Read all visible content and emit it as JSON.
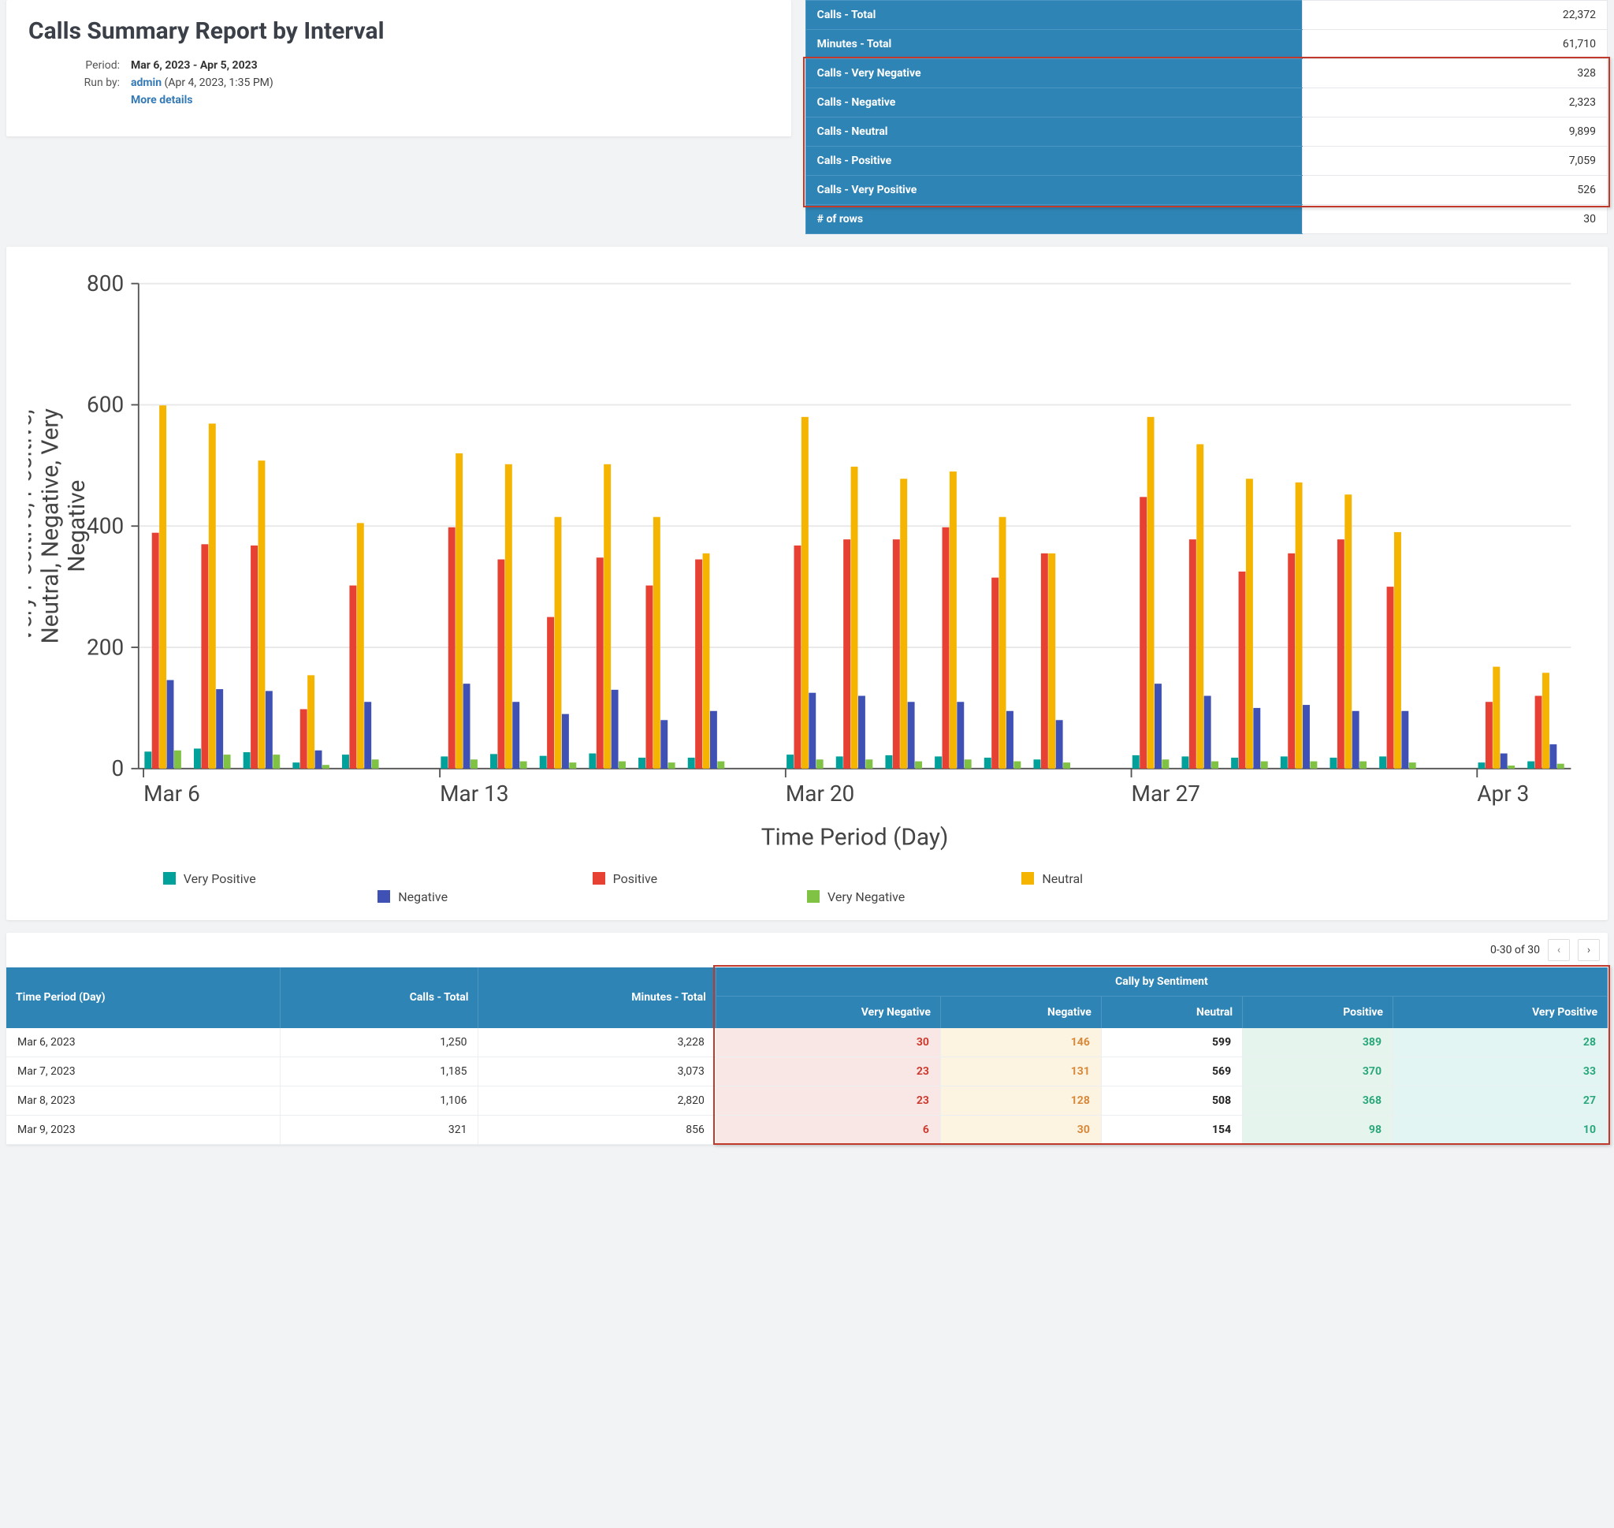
{
  "report": {
    "title": "Calls Summary Report by Interval",
    "period_label": "Period:",
    "period_value": "Mar 6, 2023 - Apr 5, 2023",
    "runby_label": "Run by:",
    "runby_user": "admin",
    "runby_time": "(Apr 4, 2023, 1:35 PM)",
    "more_details": "More details"
  },
  "summary": [
    {
      "key": "Calls - Total",
      "val": "22,372"
    },
    {
      "key": "Minutes - Total",
      "val": "61,710"
    },
    {
      "key": "Calls - Very Negative",
      "val": "328"
    },
    {
      "key": "Calls - Negative",
      "val": "2,323"
    },
    {
      "key": "Calls - Neutral",
      "val": "9,899"
    },
    {
      "key": "Calls - Positive",
      "val": "7,059"
    },
    {
      "key": "Calls - Very Positive",
      "val": "526"
    },
    {
      "key": "# of rows",
      "val": "30"
    }
  ],
  "chart_data": {
    "type": "bar",
    "xlabel": "Time Period (Day)",
    "ylabel": "Very Positive, Positive, Neutral, Negative, Very Negative",
    "ylim": [
      0,
      800
    ],
    "yticks": [
      0,
      200,
      400,
      600,
      800
    ],
    "xticks": [
      "Mar 6",
      "Mar 13",
      "Mar 20",
      "Mar 27",
      "Apr 3"
    ],
    "legend": [
      "Very Positive",
      "Positive",
      "Neutral",
      "Negative",
      "Very Negative"
    ],
    "colors": {
      "Very Positive": "#00a19a",
      "Positive": "#e64132",
      "Neutral": "#f4b400",
      "Negative": "#3f51b5",
      "Very Negative": "#7fc244"
    },
    "series": [
      {
        "name": "Very Positive",
        "values": [
          28,
          33,
          27,
          10,
          23,
          null,
          20,
          24,
          21,
          25,
          18,
          18,
          null,
          23,
          20,
          22,
          20,
          18,
          15,
          null,
          22,
          20,
          18,
          20,
          18,
          20,
          null,
          10,
          12
        ]
      },
      {
        "name": "Positive",
        "values": [
          389,
          370,
          368,
          98,
          302,
          null,
          398,
          345,
          250,
          348,
          302,
          345,
          null,
          368,
          378,
          378,
          398,
          315,
          355,
          null,
          448,
          378,
          325,
          355,
          378,
          300,
          null,
          110,
          120
        ]
      },
      {
        "name": "Neutral",
        "values": [
          599,
          569,
          508,
          154,
          405,
          null,
          520,
          502,
          415,
          502,
          415,
          355,
          null,
          580,
          498,
          478,
          490,
          415,
          355,
          null,
          580,
          535,
          478,
          472,
          452,
          390,
          null,
          168,
          158
        ]
      },
      {
        "name": "Negative",
        "values": [
          146,
          131,
          128,
          30,
          110,
          null,
          140,
          110,
          90,
          130,
          80,
          95,
          null,
          125,
          120,
          110,
          110,
          95,
          80,
          null,
          140,
          120,
          100,
          105,
          95,
          95,
          null,
          25,
          40
        ]
      },
      {
        "name": "Very Negative",
        "values": [
          30,
          23,
          23,
          6,
          15,
          null,
          15,
          12,
          10,
          12,
          10,
          12,
          null,
          15,
          15,
          12,
          15,
          12,
          10,
          null,
          15,
          12,
          12,
          12,
          12,
          10,
          null,
          5,
          8
        ]
      }
    ]
  },
  "pager": {
    "info": "0-30 of 30"
  },
  "table": {
    "group_header": "Cally by Sentiment",
    "cols": [
      "Time Period (Day)",
      "Calls - Total",
      "Minutes - Total",
      "Very Negative",
      "Negative",
      "Neutral",
      "Positive",
      "Very Positive"
    ],
    "rows": [
      {
        "period": "Mar 6, 2023",
        "calls": "1,250",
        "min": "3,228",
        "vn": "30",
        "neg": "146",
        "neu": "599",
        "pos": "389",
        "vp": "28"
      },
      {
        "period": "Mar 7, 2023",
        "calls": "1,185",
        "min": "3,073",
        "vn": "23",
        "neg": "131",
        "neu": "569",
        "pos": "370",
        "vp": "33"
      },
      {
        "period": "Mar 8, 2023",
        "calls": "1,106",
        "min": "2,820",
        "vn": "23",
        "neg": "128",
        "neu": "508",
        "pos": "368",
        "vp": "27"
      },
      {
        "period": "Mar 9, 2023",
        "calls": "321",
        "min": "856",
        "vn": "6",
        "neg": "30",
        "neu": "154",
        "pos": "98",
        "vp": "10"
      }
    ]
  }
}
